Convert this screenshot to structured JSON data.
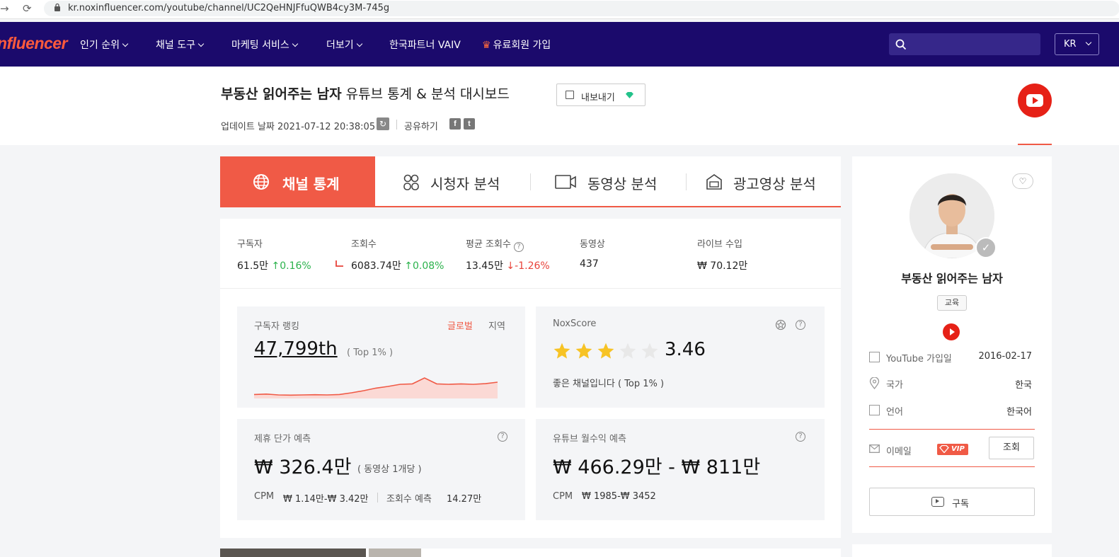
{
  "browser": {
    "url": "kr.noxinfluencer.com/youtube/channel/UC2QeHNJFfuQWB4cy3M-745g"
  },
  "topnav": {
    "logo": "nfluencer",
    "items": [
      {
        "label": "인기 순위"
      },
      {
        "label": "채널 도구"
      },
      {
        "label": "마케팅 서비스"
      },
      {
        "label": "더보기"
      },
      {
        "label": "한국파트너 VAIV"
      },
      {
        "label": "유료회원 가입"
      }
    ],
    "lang": "KR"
  },
  "header": {
    "channel_name": "부동산 읽어주는 남자",
    "title_suffix": "유튜브 통계 & 분석 대시보드",
    "export_label": "내보내기",
    "updated_label": "업데이트 날짜 2021-07-12 20:38:05",
    "share_label": "공유하기"
  },
  "tabs": [
    {
      "label": "채널 통계",
      "active": true
    },
    {
      "label": "시청자 분석",
      "active": false
    },
    {
      "label": "동영상 분석",
      "active": false
    },
    {
      "label": "광고영상 분석",
      "active": false
    }
  ],
  "stats": {
    "subscribers": {
      "label": "구독자",
      "value": "61.5만",
      "change": "0.16%"
    },
    "views": {
      "label": "조회수",
      "value": "6083.74만",
      "change": "0.08%"
    },
    "avg_views": {
      "label": "평균 조회수",
      "value": "13.45만",
      "change": "-1.26%"
    },
    "videos": {
      "label": "동영상",
      "value": "437"
    },
    "live_income": {
      "label": "라이브 수입",
      "value": "₩ 70.12만"
    }
  },
  "ranking": {
    "label": "구독자 랭킹",
    "global": "글로벌",
    "region": "지역",
    "rank": "47,799th",
    "top": "( Top 1% )",
    "trend": [
      0.12,
      0.14,
      0.1,
      0.09,
      0.1,
      0.11,
      0.1,
      0.12,
      0.2,
      0.3,
      0.42,
      0.5,
      0.6,
      0.62,
      0.9,
      0.62,
      0.6,
      0.62,
      0.6,
      0.63,
      0.7
    ]
  },
  "noxscore": {
    "label": "NoxScore",
    "score": "3.46",
    "stars_filled": 3,
    "stars_total": 5,
    "desc": "좋은 채널입니다 ( Top 1% )"
  },
  "partnership": {
    "label": "제휴 단가 예측",
    "value": "₩ 326.4만",
    "unit": "( 동영상 1개당 )",
    "cpm_label": "CPM",
    "cpm_value": "₩ 1.14만-₩ 3.42만",
    "views_label": "조회수 예측",
    "views_value": "14.27만"
  },
  "monthly": {
    "label": "유튜브 월수익 예측",
    "value": "₩ 466.29만 - ₩ 811만",
    "cpm_label": "CPM",
    "cpm_value": "₩ 1985-₩ 3452"
  },
  "side": {
    "channel_name": "부동산 읽어주는 남자",
    "category": "교육",
    "rows": [
      {
        "label": "YouTube 가입일",
        "value": "2016-02-17"
      },
      {
        "label": "국가",
        "value": "한국"
      },
      {
        "label": "언어",
        "value": "한국어"
      }
    ],
    "email_label": "이메일",
    "vip_label": "VIP",
    "lookup_label": "조회",
    "subscribe_label": "구독"
  },
  "colors": {
    "nav_bg": "#1b0a6c",
    "accent": "#f05a46",
    "up": "#2bb24c",
    "down": "#e8433a",
    "star": "#f7c325"
  }
}
